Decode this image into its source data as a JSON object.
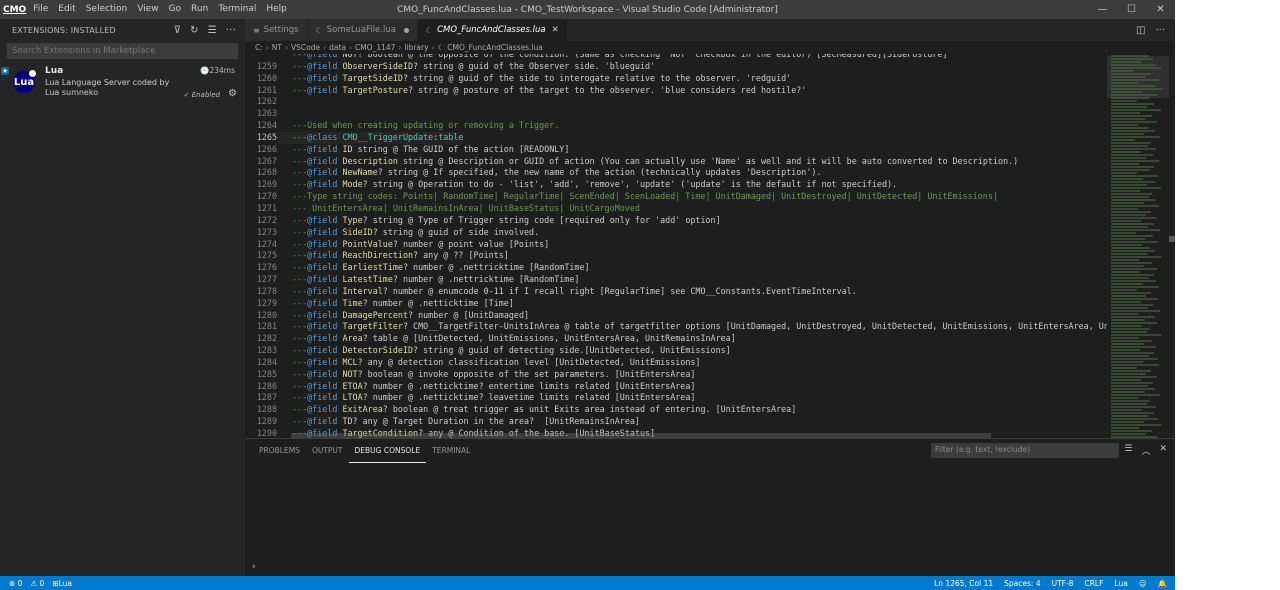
{
  "titlebar": {
    "logo": "CMO",
    "menus": [
      "File",
      "Edit",
      "Selection",
      "View",
      "Go",
      "Run",
      "Terminal",
      "Help"
    ],
    "title": "CMO_FuncAndClasses.lua - CMO_TestWorkspace - Visual Studio Code [Administrator]",
    "controls": {
      "minimize": "—",
      "maximize": "☐",
      "close": "✕"
    }
  },
  "sidebar": {
    "header": "EXTENSIONS: INSTALLED",
    "actions": {
      "filter": "⊽",
      "refresh": "↻",
      "clear": "☰",
      "more": "···"
    },
    "search_placeholder": "Search Extensions in Marketplace",
    "extension": {
      "badge": "★",
      "icon_text": "Lua",
      "name": "Lua",
      "time": "234ms",
      "description": "Lua Language Server coded by Lua sumneko",
      "status": "✓ Enabled",
      "gear": "⚙"
    }
  },
  "tabs": [
    {
      "label": "Settings",
      "icon": "≡",
      "active": false,
      "dirty": false
    },
    {
      "label": "SomeLuaFile.lua",
      "icon": "☾",
      "active": false,
      "dirty": true
    },
    {
      "label": "CMO_FuncAndClasses.lua",
      "icon": "☾",
      "active": true,
      "dirty": false
    }
  ],
  "tab_close": "✕",
  "editor_actions": {
    "split": "◫",
    "more": "···"
  },
  "breadcrumbs": [
    "C:",
    "NT",
    "VSCode",
    "data",
    "CMO_1147",
    "library",
    "CMO_FuncAndClasses.lua"
  ],
  "breadcrumb_sep": "›",
  "editor": {
    "current_line": 1265,
    "lines": [
      {
        "n": "",
        "partial": true,
        "tokens": [
          [
            "cm",
            "---"
          ],
          [
            "kw",
            "@field"
          ],
          [
            "pl",
            " "
          ],
          [
            "fn",
            "NOT"
          ],
          [
            "pl",
            "? boolean @ the opposite of the condition. (Same as checking 'NOT' checkbox in the editor) [SecMeasured][SideFosture]"
          ]
        ]
      },
      {
        "n": "1259",
        "tokens": [
          [
            "cm",
            "---"
          ],
          [
            "kw",
            "@field"
          ],
          [
            "pl",
            " "
          ],
          [
            "fn",
            "ObserverSideID"
          ],
          [
            "pl",
            "? string @ guid of the Observer side. 'blueguid'"
          ]
        ]
      },
      {
        "n": "1260",
        "tokens": [
          [
            "cm",
            "---"
          ],
          [
            "kw",
            "@field"
          ],
          [
            "pl",
            " "
          ],
          [
            "fn",
            "TargetSideID"
          ],
          [
            "pl",
            "? string @ guid of the side to interogate relative to the observer. 'redguid'"
          ]
        ]
      },
      {
        "n": "1261",
        "tokens": [
          [
            "cm",
            "---"
          ],
          [
            "kw",
            "@field"
          ],
          [
            "pl",
            " "
          ],
          [
            "fn",
            "TargetPosture"
          ],
          [
            "pl",
            "? string @ posture of the target to the observer. 'blue considers red hostile?'"
          ]
        ]
      },
      {
        "n": "1262",
        "tokens": []
      },
      {
        "n": "1263",
        "tokens": []
      },
      {
        "n": "1264",
        "tokens": [
          [
            "cm",
            "---Used when creating updating or removing a Trigger."
          ]
        ]
      },
      {
        "n": "1265",
        "tokens": [
          [
            "cm",
            "---"
          ],
          [
            "kw",
            "@class"
          ],
          [
            "pl",
            " "
          ],
          [
            "ty",
            "CMO__TriggerUpdate"
          ],
          [
            "pl",
            ":"
          ],
          [
            "ty",
            "table"
          ]
        ]
      },
      {
        "n": "1266",
        "tokens": [
          [
            "cm",
            "---"
          ],
          [
            "kw",
            "@field"
          ],
          [
            "pl",
            " "
          ],
          [
            "fn",
            "ID"
          ],
          [
            "pl",
            " string @ The GUID of the action [READONLY]"
          ]
        ]
      },
      {
        "n": "1267",
        "tokens": [
          [
            "cm",
            "---"
          ],
          [
            "kw",
            "@field"
          ],
          [
            "pl",
            " "
          ],
          [
            "fn",
            "Description"
          ],
          [
            "pl",
            " string @ Description or GUID of action (You can actually use 'Name' as well and it will be auto converted to Description.)"
          ]
        ]
      },
      {
        "n": "1268",
        "tokens": [
          [
            "cm",
            "---"
          ],
          [
            "kw",
            "@field"
          ],
          [
            "pl",
            " "
          ],
          [
            "fn",
            "NewName"
          ],
          [
            "pl",
            "? string @ If specified, the new name of the action (technically updates 'Description')."
          ]
        ]
      },
      {
        "n": "1269",
        "tokens": [
          [
            "cm",
            "---"
          ],
          [
            "kw",
            "@field"
          ],
          [
            "pl",
            " "
          ],
          [
            "fn",
            "Mode"
          ],
          [
            "pl",
            "? string @ Operation to do - 'list', 'add', 'remove', 'update' ('update' is the default if not specified)."
          ]
        ]
      },
      {
        "n": "1270",
        "tokens": [
          [
            "cm",
            "---Type string codes: Points| RandomTime| RegularTime| ScenEnded| ScenLoaded| Time| UnitDamaged| UnitDestroyed| UnitDetected| UnitEmissions|"
          ]
        ]
      },
      {
        "n": "1271",
        "tokens": [
          [
            "cm",
            "--- UnitEntersArea| UnitRemainsInArea| UnitBaseStatus| UnitCargoMoved"
          ]
        ]
      },
      {
        "n": "1272",
        "tokens": [
          [
            "cm",
            "---"
          ],
          [
            "kw",
            "@field"
          ],
          [
            "pl",
            " "
          ],
          [
            "fn",
            "Type"
          ],
          [
            "pl",
            "? string @ Type of Trigger string code [required only for 'add' option]"
          ]
        ]
      },
      {
        "n": "1273",
        "tokens": [
          [
            "cm",
            "---"
          ],
          [
            "kw",
            "@field"
          ],
          [
            "pl",
            " "
          ],
          [
            "fn",
            "SideID"
          ],
          [
            "pl",
            "? string @ guid of side involved."
          ]
        ]
      },
      {
        "n": "1274",
        "tokens": [
          [
            "cm",
            "---"
          ],
          [
            "kw",
            "@field"
          ],
          [
            "pl",
            " "
          ],
          [
            "fn",
            "PointValue"
          ],
          [
            "pl",
            "? number @ point value [Points]"
          ]
        ]
      },
      {
        "n": "1275",
        "tokens": [
          [
            "cm",
            "---"
          ],
          [
            "kw",
            "@field"
          ],
          [
            "pl",
            " "
          ],
          [
            "fn",
            "ReachDirection"
          ],
          [
            "pl",
            "? any @ ?? [Points]"
          ]
        ]
      },
      {
        "n": "1276",
        "tokens": [
          [
            "cm",
            "---"
          ],
          [
            "kw",
            "@field"
          ],
          [
            "pl",
            " "
          ],
          [
            "fn",
            "EarliestTime"
          ],
          [
            "pl",
            "? number @ .nettricktime [RandomTime]"
          ]
        ]
      },
      {
        "n": "1277",
        "tokens": [
          [
            "cm",
            "---"
          ],
          [
            "kw",
            "@field"
          ],
          [
            "pl",
            " "
          ],
          [
            "fn",
            "LatestTime"
          ],
          [
            "pl",
            "? number @ .nettricktime [RandomTime]"
          ]
        ]
      },
      {
        "n": "1278",
        "tokens": [
          [
            "cm",
            "---"
          ],
          [
            "kw",
            "@field"
          ],
          [
            "pl",
            " "
          ],
          [
            "fn",
            "Interval"
          ],
          [
            "pl",
            "? number @ enumcode 0-11 if I recall right [RegularTime] see CMO__Constants.EventTimeInterval."
          ]
        ]
      },
      {
        "n": "1279",
        "tokens": [
          [
            "cm",
            "---"
          ],
          [
            "kw",
            "@field"
          ],
          [
            "pl",
            " "
          ],
          [
            "fn",
            "Time"
          ],
          [
            "pl",
            "? number @ .netticktime [Time]"
          ]
        ]
      },
      {
        "n": "1280",
        "tokens": [
          [
            "cm",
            "---"
          ],
          [
            "kw",
            "@field"
          ],
          [
            "pl",
            " "
          ],
          [
            "fn",
            "DamagePercent"
          ],
          [
            "pl",
            "? number @ [UnitDamaged]"
          ]
        ]
      },
      {
        "n": "1281",
        "tokens": [
          [
            "cm",
            "---"
          ],
          [
            "kw",
            "@field"
          ],
          [
            "pl",
            " "
          ],
          [
            "fn",
            "TargetFilter"
          ],
          [
            "pl",
            "? CMO__TargetFilter-UnitsInArea @ table of targetfilter options [UnitDamaged, UnitDestroyed, UnitDetected, UnitEmissions, UnitEntersArea, UnitRemai"
          ]
        ]
      },
      {
        "n": "1282",
        "tokens": [
          [
            "cm",
            "---"
          ],
          [
            "kw",
            "@field"
          ],
          [
            "pl",
            " "
          ],
          [
            "fn",
            "Area"
          ],
          [
            "pl",
            "? table @ [UnitDetected, UnitEmissions, UnitEntersArea, UnitRemainsInArea]"
          ]
        ]
      },
      {
        "n": "1283",
        "tokens": [
          [
            "cm",
            "---"
          ],
          [
            "kw",
            "@field"
          ],
          [
            "pl",
            " "
          ],
          [
            "fn",
            "DetectorSideID"
          ],
          [
            "pl",
            "? string @ guid of detecting side.[UnitDetected, UnitEmissions]"
          ]
        ]
      },
      {
        "n": "1284",
        "tokens": [
          [
            "cm",
            "---"
          ],
          [
            "kw",
            "@field"
          ],
          [
            "pl",
            " "
          ],
          [
            "fn",
            "MCL"
          ],
          [
            "pl",
            "? any @ detection classification level [UnitDetected, UnitEmissions]"
          ]
        ]
      },
      {
        "n": "1285",
        "tokens": [
          [
            "cm",
            "---"
          ],
          [
            "kw",
            "@field"
          ],
          [
            "pl",
            " "
          ],
          [
            "fn",
            "NOT"
          ],
          [
            "pl",
            "? boolean @ invoke opposite of the set parameters. [UnitEntersArea]"
          ]
        ]
      },
      {
        "n": "1286",
        "tokens": [
          [
            "cm",
            "---"
          ],
          [
            "kw",
            "@field"
          ],
          [
            "pl",
            " "
          ],
          [
            "fn",
            "ETOA"
          ],
          [
            "pl",
            "? number @ .netticktime? entertime limits related [UnitEntersArea]"
          ]
        ]
      },
      {
        "n": "1287",
        "tokens": [
          [
            "cm",
            "---"
          ],
          [
            "kw",
            "@field"
          ],
          [
            "pl",
            " "
          ],
          [
            "fn",
            "LTOA"
          ],
          [
            "pl",
            "? number @ .netticktime? leavetime limits related [UnitEntersArea]"
          ]
        ]
      },
      {
        "n": "1288",
        "tokens": [
          [
            "cm",
            "---"
          ],
          [
            "kw",
            "@field"
          ],
          [
            "pl",
            " "
          ],
          [
            "fn",
            "ExitArea"
          ],
          [
            "pl",
            "? boolean @ treat trigger as unit Exits area instead of entering. [UnitEntersArea]"
          ]
        ]
      },
      {
        "n": "1289",
        "tokens": [
          [
            "cm",
            "---"
          ],
          [
            "kw",
            "@field"
          ],
          [
            "pl",
            " "
          ],
          [
            "fn",
            "TD"
          ],
          [
            "pl",
            "? any @ Target Duration in the area?  [UnitRemainsInArea]"
          ]
        ]
      },
      {
        "n": "1290",
        "tokens": [
          [
            "cm",
            "---"
          ],
          [
            "kw",
            "@field"
          ],
          [
            "pl",
            " "
          ],
          [
            "fn",
            "TargetCondition"
          ],
          [
            "pl",
            "? any @ Condition of the base. [UnitBaseStatus]"
          ]
        ]
      }
    ]
  },
  "panel": {
    "tabs": [
      {
        "label": "PROBLEMS",
        "active": false
      },
      {
        "label": "OUTPUT",
        "active": false
      },
      {
        "label": "DEBUG CONSOLE",
        "active": true
      },
      {
        "label": "TERMINAL",
        "active": false
      }
    ],
    "filter_placeholder": "Filter (e.g. text, !exclude)",
    "actions": {
      "clear": "☰",
      "maximize": "︿",
      "close": "✕"
    },
    "prompt": "›"
  },
  "statusbar": {
    "errors": "⊗ 0",
    "warnings": "⚠ 0",
    "language_server": "⊞Lua",
    "cursor": "Ln 1265, Col 11",
    "spaces": "Spaces: 4",
    "encoding": "UTF-8",
    "eol": "CRLF",
    "language": "Lua",
    "feedback": "☺",
    "notifications": "🔔"
  }
}
